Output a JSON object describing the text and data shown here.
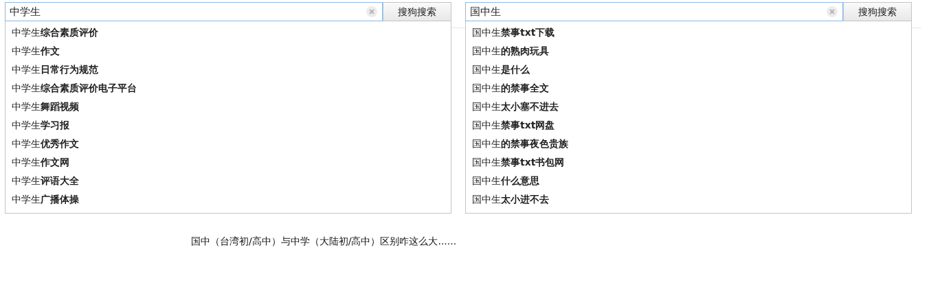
{
  "search_panels": [
    {
      "query": "中学生",
      "button": "搜狗搜索",
      "suggestions": [
        "中学生**综合素质评价**",
        "中学生**作文**",
        "中学生**日常行为规范**",
        "中学生**综合素质评价电子平台**",
        "中学生**舞蹈视频**",
        "中学生**学习报**",
        "中学生**优秀作文**",
        "中学生**作文网**",
        "中学生**评语大全**",
        "中学生**广播体操**"
      ]
    },
    {
      "query": "国中生",
      "button": "搜狗搜索",
      "suggestions": [
        "国中生**禁事txt下载**",
        "国中生**的熟肉玩具**",
        "国中生**是什么**",
        "国中生**的禁事全文**",
        "国中生**太小塞不进去**",
        "国中生**禁事txt网盘**",
        "国中生**的禁事夜色贵族**",
        "国中生**禁事txt书包网**",
        "国中生**什么意思**",
        "国中生**太小进不去**"
      ]
    }
  ],
  "caption": "国中（台湾初/高中）与中学（大陆初/高中）区别咋这么大......"
}
